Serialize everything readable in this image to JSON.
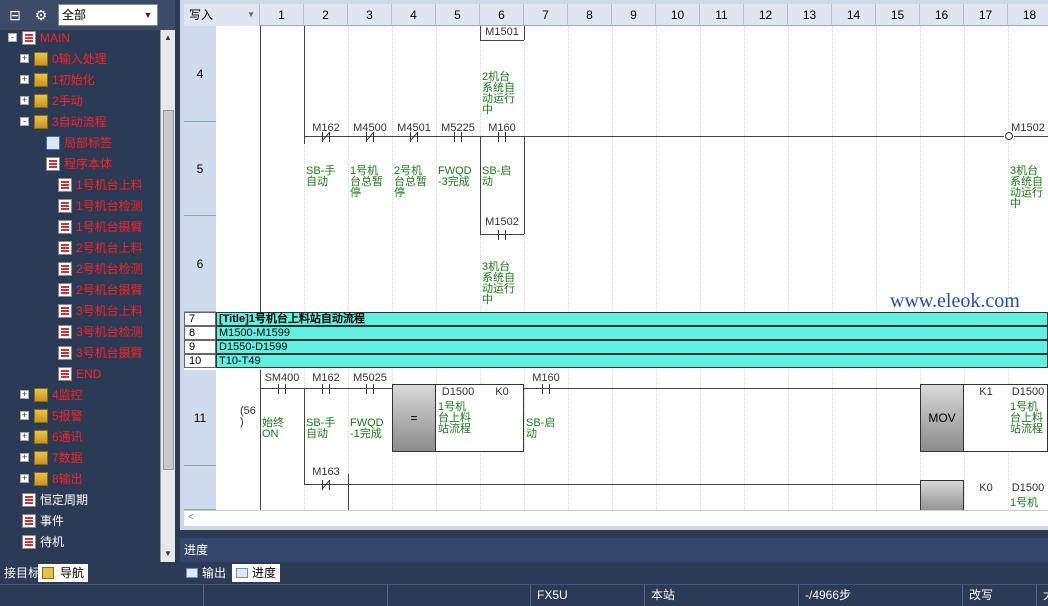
{
  "nav": {
    "scope": "全部",
    "tree": [
      {
        "label": "MAIN",
        "color": "red",
        "expander": "-",
        "icon": "program"
      },
      {
        "label": "0输入处理",
        "color": "red",
        "expander": "+",
        "icon": "folder"
      },
      {
        "label": "1初始化",
        "color": "red",
        "expander": "+",
        "icon": "folder"
      },
      {
        "label": "2手动",
        "color": "red",
        "expander": "+",
        "icon": "folder"
      },
      {
        "label": "3自动流程",
        "color": "red",
        "expander": "-",
        "icon": "folder"
      },
      {
        "label": "局部标签",
        "color": "red",
        "expander": "",
        "icon": "local-label"
      },
      {
        "label": "程序本体",
        "color": "red",
        "expander": "",
        "icon": "program"
      },
      {
        "label": "1号机台上料",
        "color": "red",
        "expander": "",
        "icon": "program"
      },
      {
        "label": "1号机台检测",
        "color": "red",
        "expander": "",
        "icon": "program"
      },
      {
        "label": "1号机台摄臂",
        "color": "red",
        "expander": "",
        "icon": "program"
      },
      {
        "label": "2号机台上料",
        "color": "red",
        "expander": "",
        "icon": "program"
      },
      {
        "label": "2号机台检测",
        "color": "red",
        "expander": "",
        "icon": "program"
      },
      {
        "label": "2号机台摄臂",
        "color": "red",
        "expander": "",
        "icon": "program"
      },
      {
        "label": "3号机台上料",
        "color": "red",
        "expander": "",
        "icon": "program"
      },
      {
        "label": "3号机台检测",
        "color": "red",
        "expander": "",
        "icon": "program"
      },
      {
        "label": "3号机台摄臂",
        "color": "red",
        "expander": "",
        "icon": "program"
      },
      {
        "label": "END",
        "color": "red",
        "expander": "",
        "icon": "program"
      },
      {
        "label": "4监控",
        "color": "red",
        "expander": "+",
        "icon": "folder"
      },
      {
        "label": "5报警",
        "color": "red",
        "expander": "+",
        "icon": "folder"
      },
      {
        "label": "6通讯",
        "color": "red",
        "expander": "+",
        "icon": "folder"
      },
      {
        "label": "7数据",
        "color": "red",
        "expander": "+",
        "icon": "folder"
      },
      {
        "label": "8输出",
        "color": "red",
        "expander": "+",
        "icon": "folder"
      },
      {
        "label": "恒定周期",
        "color": "white",
        "expander": "",
        "icon": "program"
      },
      {
        "label": "事件",
        "color": "white",
        "expander": "",
        "icon": "program"
      },
      {
        "label": "待机",
        "color": "white",
        "expander": "",
        "icon": "program"
      }
    ],
    "tabs": {
      "target": "接目标",
      "navigation": "导航"
    }
  },
  "ladder": {
    "mode": "写入",
    "columns": [
      "1",
      "2",
      "3",
      "4",
      "5",
      "6",
      "7",
      "8",
      "9",
      "10",
      "11",
      "12",
      "13",
      "14",
      "15",
      "16",
      "17",
      "18"
    ],
    "rows": {
      "r4": "4",
      "r5": "5",
      "r6": "6",
      "r11": "11"
    },
    "r4": {
      "dev": "M1501",
      "cmt": "2机台\n系统自\n动运行\n中"
    },
    "r5": {
      "c2": {
        "dev": "M162",
        "cmt": "SB-手\n自动"
      },
      "c3": {
        "dev": "M4500",
        "cmt": "1号机\n台总暂\n停"
      },
      "c4": {
        "dev": "M4501",
        "cmt": "2号机\n台总暂\n停"
      },
      "c5": {
        "dev": "M5225",
        "cmt": "FWQD\n-3完成"
      },
      "c6": {
        "dev": "M160",
        "cmt": "SB-启\n动"
      },
      "coil": {
        "dev": "M1502",
        "cmt": "3机台\n系统自\n动运行\n中"
      }
    },
    "r6": {
      "dev": "M1502",
      "cmt": "3机台\n系统自\n动运行\n中"
    },
    "bands": [
      {
        "num": "7",
        "text": "[Title]1号机台上料站自动流程"
      },
      {
        "num": "8",
        "text": "M1500-M1599"
      },
      {
        "num": "9",
        "text": "D1550-D1599"
      },
      {
        "num": "10",
        "text": "T10-T49"
      }
    ],
    "r11": {
      "step": "(56\n)",
      "c1": {
        "dev": "SM400",
        "cmt": "始终\nON"
      },
      "c2": {
        "dev": "M162",
        "cmt": "SB-手\n自动"
      },
      "c3": {
        "dev": "M5025",
        "cmt": "FWQD\n-1完成"
      },
      "cmp": {
        "op": "=",
        "s1": "D1500",
        "s1cmt": "1号机\n台上料\n站流程",
        "s2": "K0"
      },
      "c6": {
        "dev": "M160",
        "cmt": "SB-启\n动"
      },
      "mov": {
        "op": "MOV",
        "s": "K1",
        "d": "D1500",
        "dcmt": "1号机\n台上料\n站流程"
      }
    },
    "r12": {
      "dev": "M163",
      "mov": {
        "op": "MOV",
        "s": "K0",
        "d": "D1500",
        "dcmt": "1号机"
      }
    },
    "watermark": "www.eleok.com"
  },
  "panel": {
    "progress_title": "进度",
    "tabs": {
      "output": "输出",
      "progress": "进度"
    }
  },
  "statusbar": {
    "cpu": "FX5U",
    "station": "本站",
    "steps": "-/4966步",
    "mode": "改写",
    "extra": "大"
  }
}
